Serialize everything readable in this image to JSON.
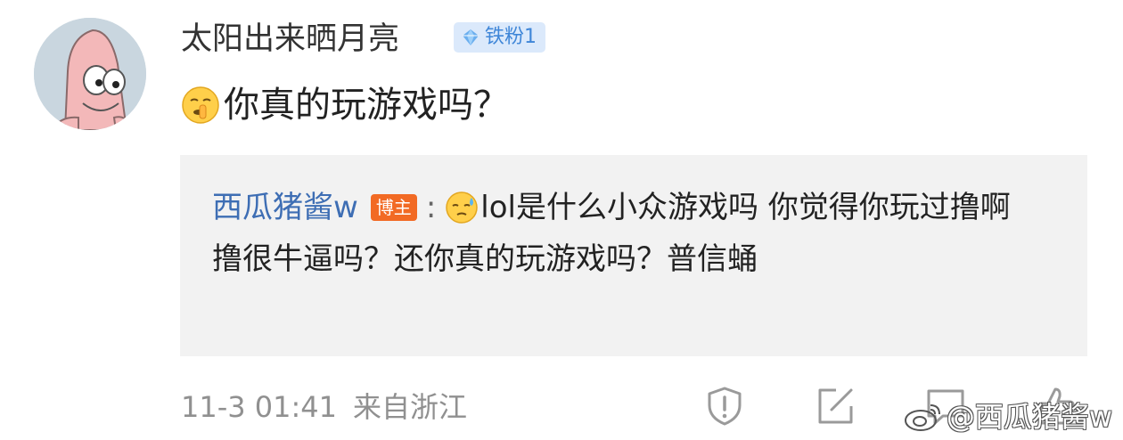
{
  "comment": {
    "username": "太阳出来晒月亮",
    "fan_badge": "铁粉1",
    "text": "你真的玩游戏吗？",
    "emoji": "shush-emoji"
  },
  "reply": {
    "author": "西瓜猪酱w",
    "author_badge": "博主",
    "colon": ":",
    "emoji": "sweat-emoji",
    "text": "lol是什么小众游戏吗 你觉得你玩过撸啊撸很牛逼吗？还你真的玩游戏吗？普信蛹"
  },
  "meta": {
    "timestamp": "11-3 01:41",
    "location": "来自浙江"
  },
  "actions": {
    "report_icon": "shield-alert-icon",
    "edit_icon": "edit-icon",
    "comment_icon": "comment-icon",
    "like_icon": "like-icon"
  },
  "watermark": {
    "text": "@西瓜猪酱w"
  },
  "colors": {
    "username": "#333333",
    "reply_author": "#3e6eb4",
    "fan_badge_bg": "#dbe9fb",
    "fan_badge_text": "#3f86d8",
    "blogger_badge_bg": "#f26a24",
    "reply_bg": "#f2f2f2",
    "meta_text": "#909090"
  }
}
